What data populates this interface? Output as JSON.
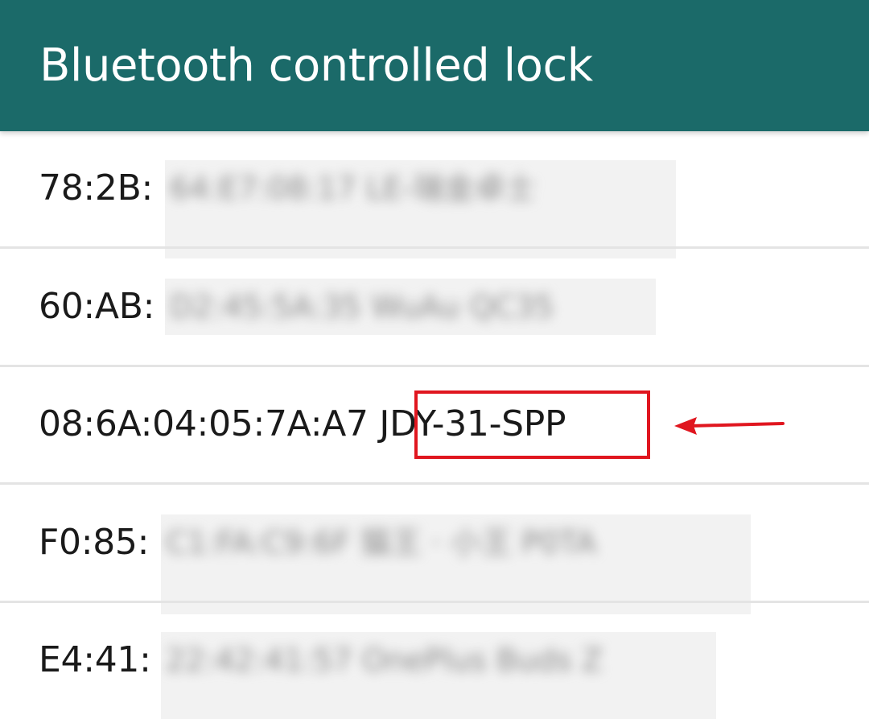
{
  "app_bar": {
    "title": "Bluetooth controlled lock",
    "color": "#1b6a69"
  },
  "devices": [
    {
      "label": "78:2B:",
      "obscured": "64:E7:08:17 LE-瑞金卓士"
    },
    {
      "label": "60:AB:",
      "obscured": "D2:45:5A:35 WuAu QC35"
    },
    {
      "label": "08:6A:04:05:7A:A7 JDY-31-SPP",
      "obscured": ""
    },
    {
      "label": "F0:85:",
      "obscured": "C1:FA:C9:6F 猫王 · 小王 P0TA"
    },
    {
      "label": "E4:41:",
      "obscured": "22:42:41:57 OnePlus Buds Z"
    }
  ],
  "annotation": {
    "highlight_color": "#e0161f",
    "arrow_icon": "left-arrow"
  }
}
